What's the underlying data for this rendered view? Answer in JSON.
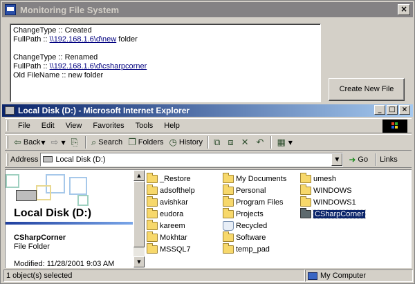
{
  "app_window": {
    "title": "Monitoring File System",
    "close_glyph": "×"
  },
  "log": {
    "lines": [
      {
        "prefix": "ChangeType :: Created",
        "link": "",
        "suffix": ""
      },
      {
        "prefix": "FullPath :: ",
        "link": "\\\\192.168.1.6\\d\\new",
        "suffix": " folder"
      },
      {
        "prefix": "",
        "link": "",
        "suffix": ""
      },
      {
        "prefix": "ChangeType :: Renamed",
        "link": "",
        "suffix": ""
      },
      {
        "prefix": "FullPath :: ",
        "link": "\\\\192.168.1.6\\d\\csharpcorner",
        "suffix": ""
      },
      {
        "prefix": "Old FileName :: new folder",
        "link": "",
        "suffix": ""
      }
    ]
  },
  "create_button": {
    "label": "Create New File"
  },
  "ie_window": {
    "title": "Local Disk (D:) - Microsoft Internet Explorer",
    "min_glyph": "_",
    "max_glyph": "□",
    "close_glyph": "×"
  },
  "menu": {
    "items": [
      "File",
      "Edit",
      "View",
      "Favorites",
      "Tools",
      "Help"
    ]
  },
  "toolbar": {
    "back_label": "Back",
    "search_label": "Search",
    "folders_label": "Folders",
    "history_label": "History"
  },
  "address": {
    "label": "Address",
    "value": "Local Disk (D:)",
    "go_label": "Go",
    "links_label": "Links"
  },
  "left_pane": {
    "heading": "Local Disk (D:)",
    "selected_name": "CSharpCorner",
    "selected_type": "File Folder",
    "modified": "Modified: 11/28/2001 9:03 AM"
  },
  "files": {
    "col1": [
      "_Restore",
      "adsofthelp",
      "avishkar",
      "eudora",
      "kareem",
      "Mokhtar",
      "MSSQL7"
    ],
    "col2": [
      "My Documents",
      "Personal",
      "Program Files",
      "Projects",
      "Recycled",
      "Software",
      "temp_pad"
    ],
    "col3": [
      "umesh",
      "WINDOWS",
      "WINDOWS1",
      "CSharpCorner"
    ],
    "selected": "CSharpCorner"
  },
  "statusbar": {
    "objects": "1 object(s) selected",
    "zone": "My Computer"
  },
  "colors": {
    "ie_title_start": "#0a246a",
    "ie_title_end": "#a6caf0",
    "chrome": "#d4d0c8",
    "selection": "#0a246a",
    "link": "#00007f"
  }
}
